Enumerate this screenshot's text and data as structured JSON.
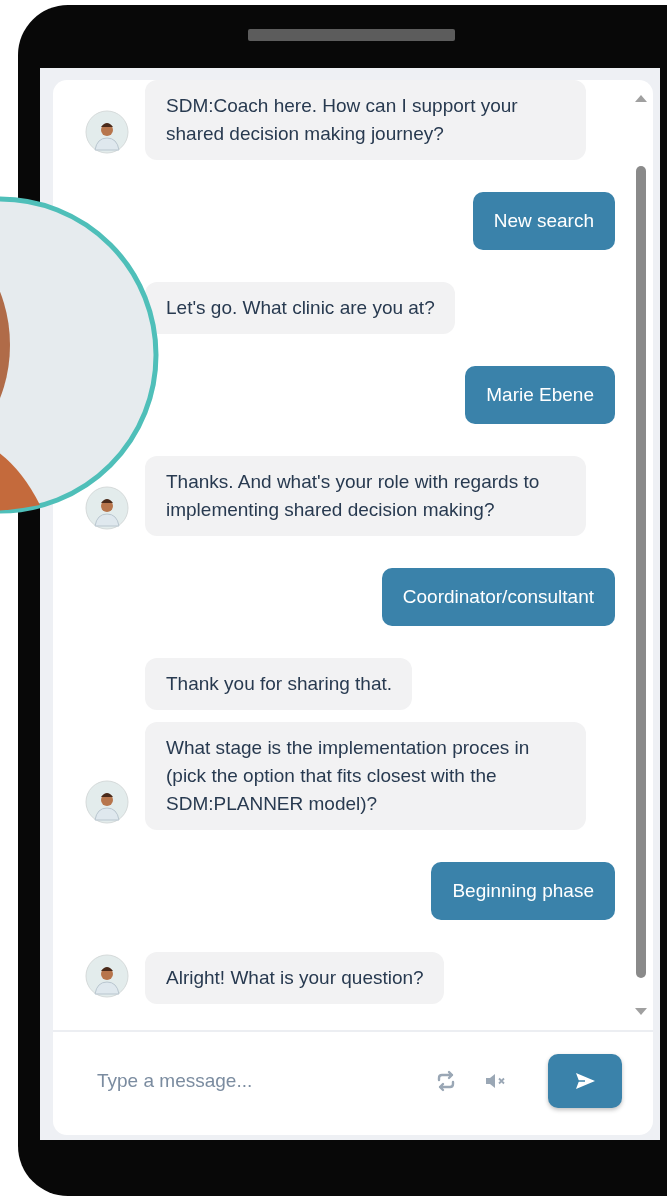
{
  "messages": [
    {
      "kind": "bot",
      "avatar": true,
      "text": "SDM:Coach here. How can I support your shared decision making journey?"
    },
    {
      "kind": "user",
      "text": "New search"
    },
    {
      "kind": "bot",
      "avatar": false,
      "text": "Let's go. What clinic are you at?"
    },
    {
      "kind": "user",
      "text": "Marie Ebene"
    },
    {
      "kind": "bot",
      "avatar": true,
      "text": "Thanks. And what's your role with regards to implementing shared decision making?"
    },
    {
      "kind": "user",
      "text": "Coordinator/consultant"
    },
    {
      "kind": "bot",
      "avatar": false,
      "text": "Thank you for sharing that."
    },
    {
      "kind": "bot",
      "avatar": true,
      "text": "What stage is the implementation proces in (pick the option that fits closest with the SDM:PLANNER model)?"
    },
    {
      "kind": "user",
      "text": "Beginning phase"
    },
    {
      "kind": "bot",
      "avatar": true,
      "text": "Alright! What is your question?"
    }
  ],
  "composer": {
    "placeholder": "Type a message..."
  }
}
